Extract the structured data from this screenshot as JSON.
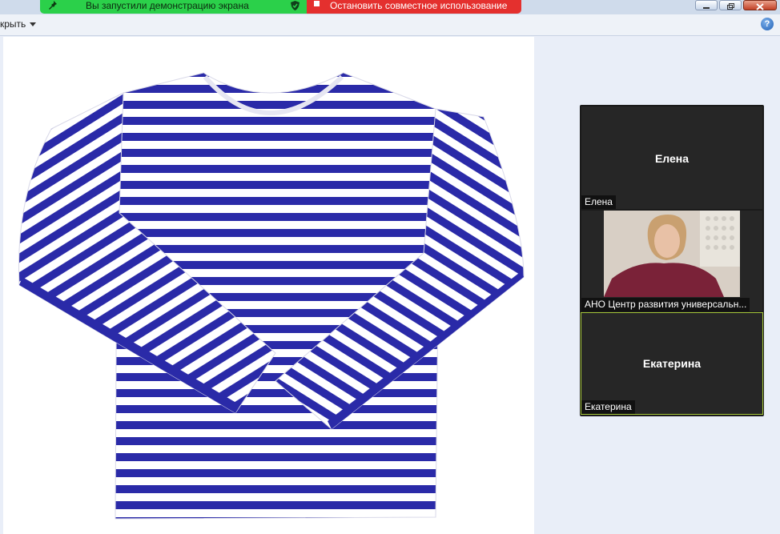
{
  "share_bar": {
    "status_text": "Вы запустили демонстрацию экрана",
    "stop_text": "Остановить совместное использование"
  },
  "toolbar": {
    "menu_label": "крыть",
    "help_label": "?"
  },
  "participants": [
    {
      "display": "Елена",
      "name_tag": "Елена",
      "video": false
    },
    {
      "display": "",
      "name_tag": "АНО Центр развития универсальн...",
      "video": true
    },
    {
      "display": "Екатерина",
      "name_tag": "Екатерина",
      "video": false,
      "active_speaker": true
    }
  ],
  "colors": {
    "share_green": "#2bd04a",
    "stop_red": "#e4302e",
    "stripe_blue": "#2a2aa8",
    "active_border": "#a4c639"
  },
  "icons": {
    "share_pin": "pin-icon",
    "share_shield": "shield-check-icon",
    "stop": "stop-square-icon",
    "help": "help-icon"
  }
}
